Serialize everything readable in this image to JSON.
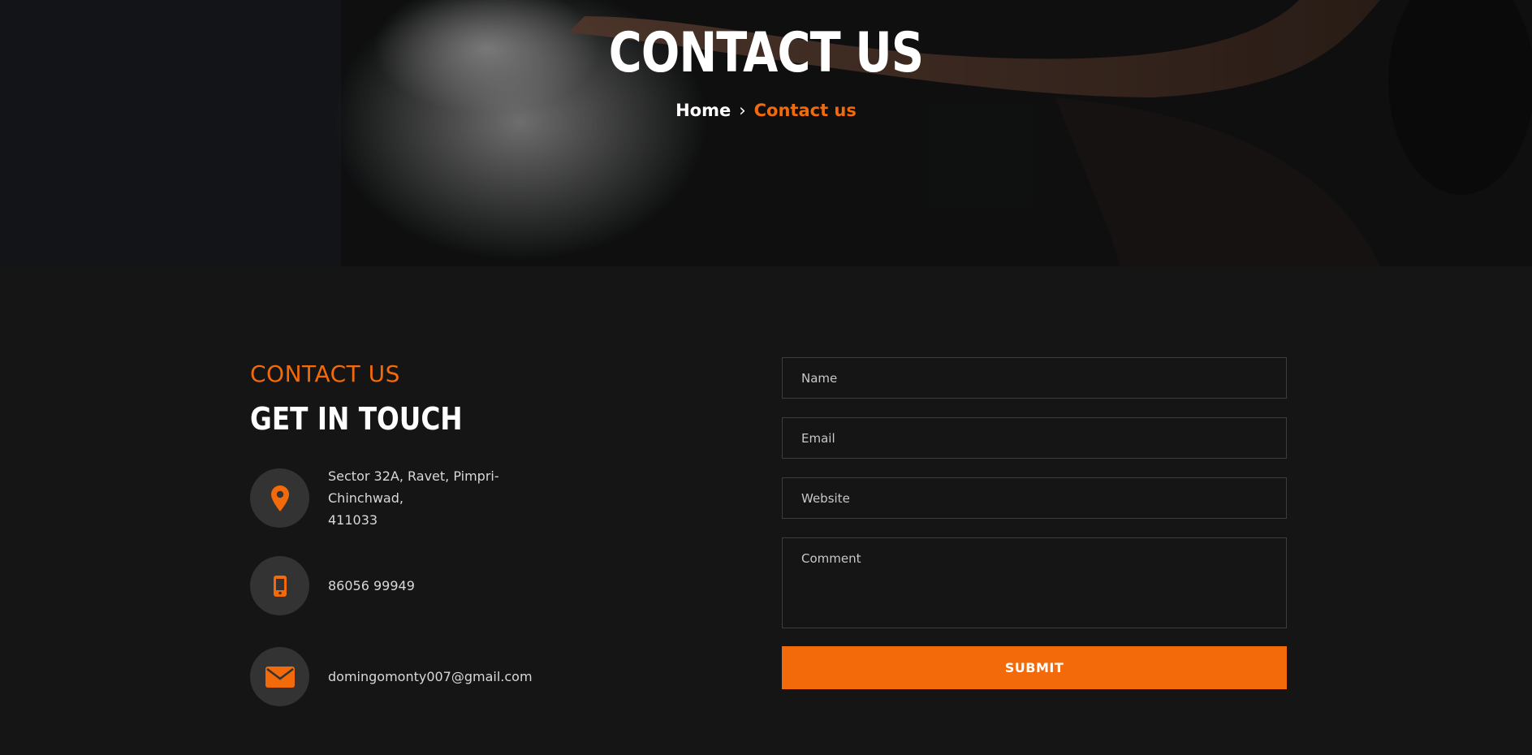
{
  "hero": {
    "title": "CONTACT US",
    "breadcrumb": {
      "home": "Home",
      "separator": "›",
      "current": "Contact us"
    }
  },
  "contact": {
    "kicker": "CONTACT US",
    "heading": "GET IN TOUCH",
    "items": [
      {
        "icon": "map-pin-icon",
        "text_line1": "Sector 32A, Ravet, Pimpri-Chinchwad,",
        "text_line2": "411033"
      },
      {
        "icon": "mobile-phone-icon",
        "text": "86056 99949"
      },
      {
        "icon": "envelope-icon",
        "text": "domingomonty007@gmail.com"
      }
    ]
  },
  "form": {
    "name_placeholder": "Name",
    "email_placeholder": "Email",
    "website_placeholder": "Website",
    "comment_placeholder": "Comment",
    "submit_label": "SUBMIT"
  },
  "colors": {
    "accent": "#f26a0a",
    "background": "#151515",
    "icon_circle": "#333333"
  }
}
